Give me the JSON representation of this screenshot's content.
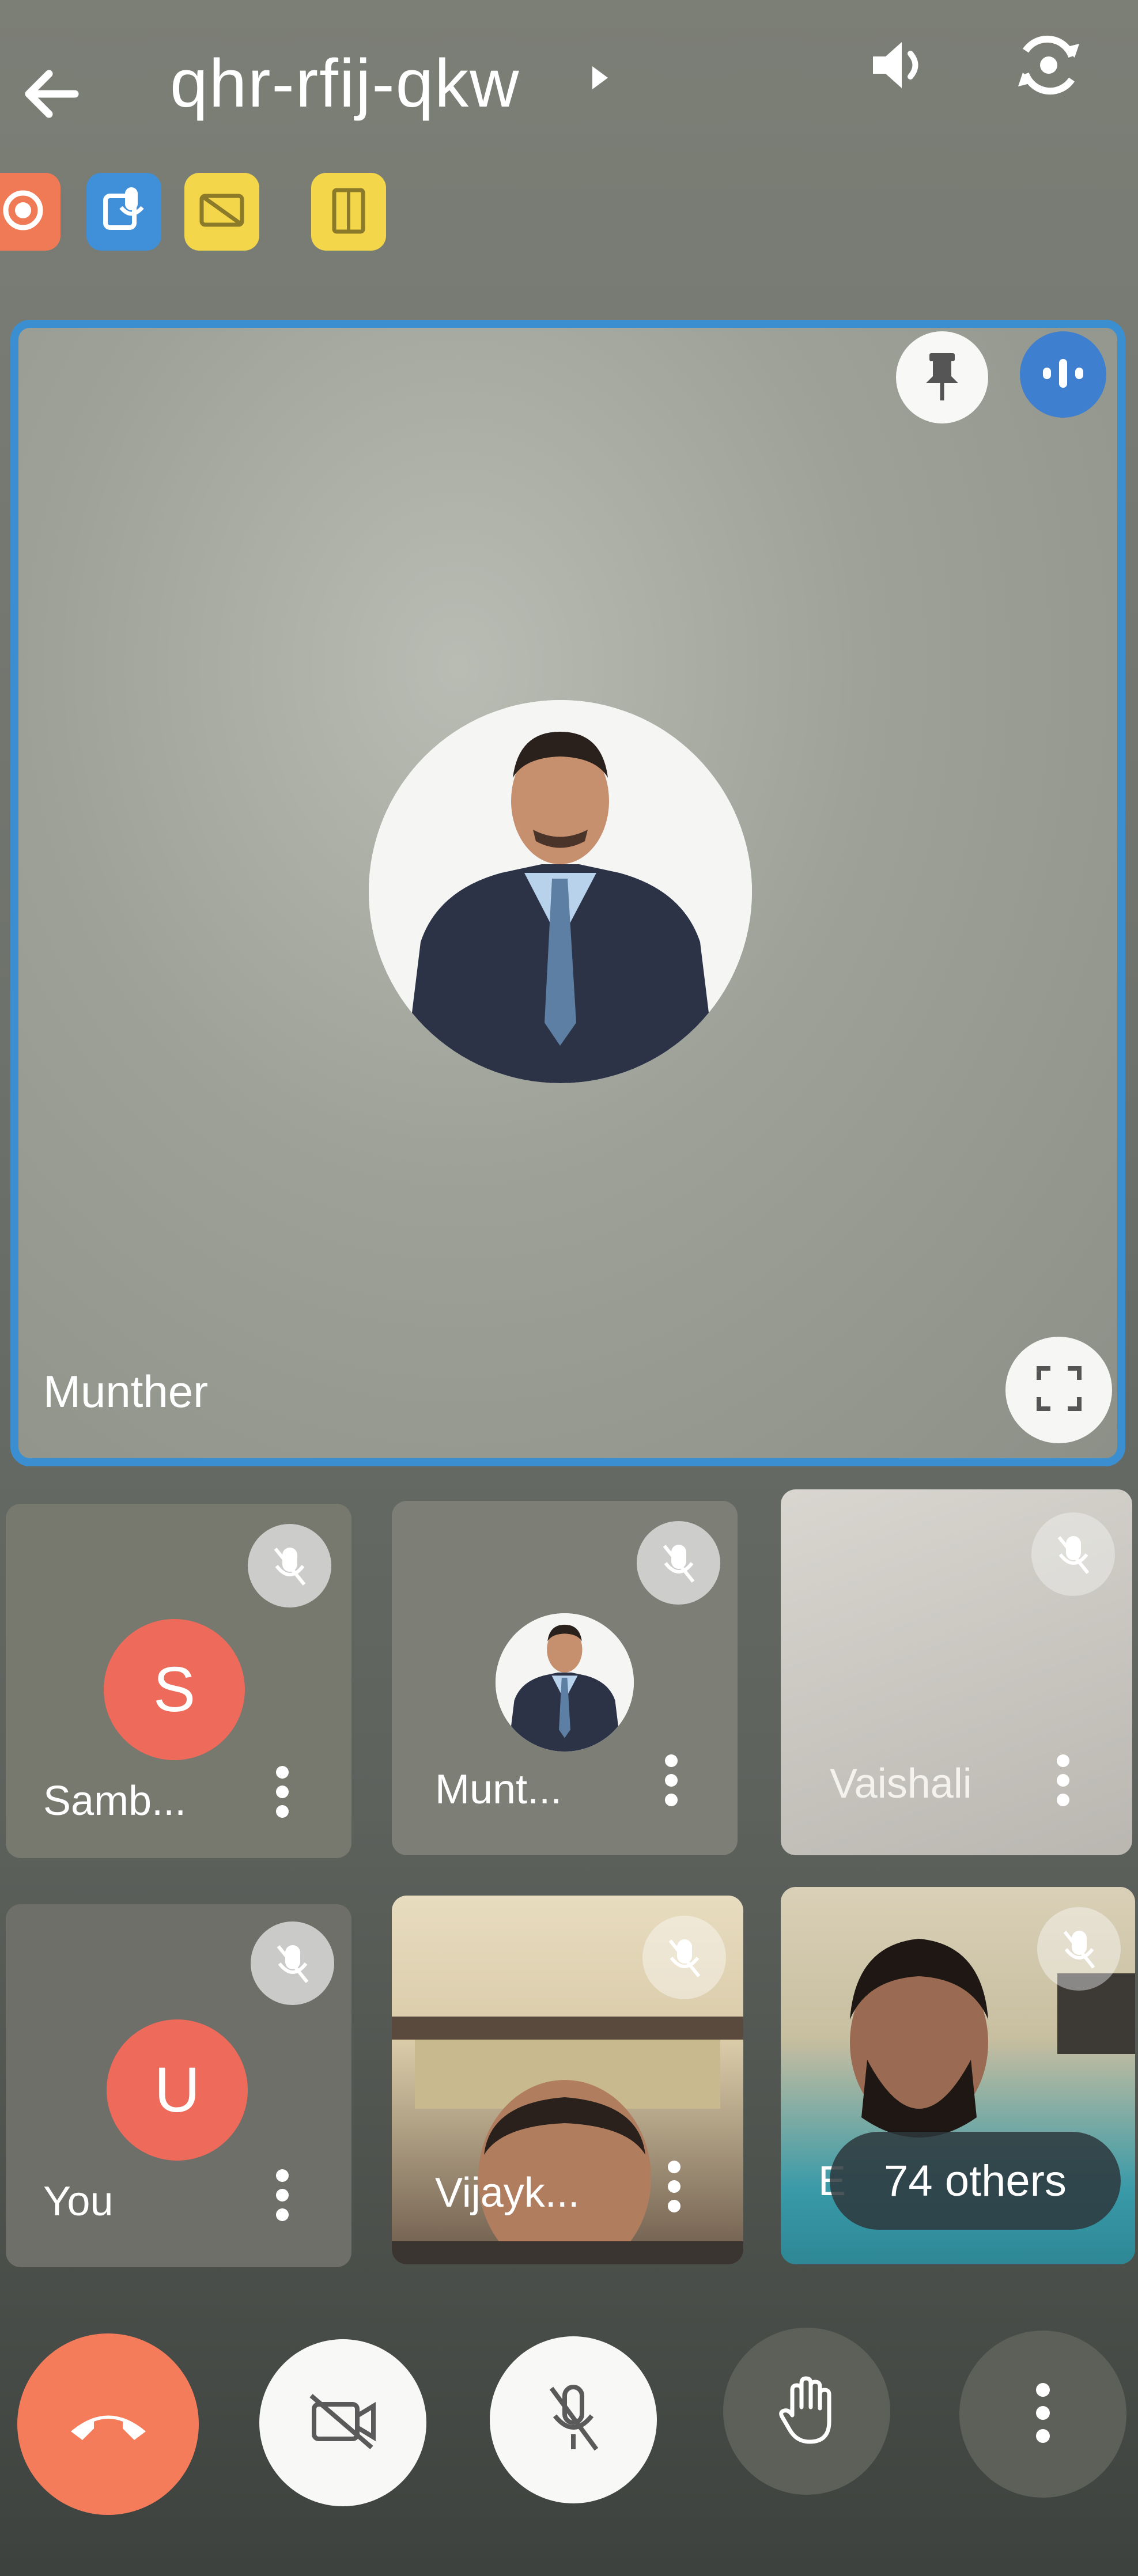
{
  "header": {
    "meeting_code": "qhr-rfij-qkw",
    "back_icon": "arrow-left-icon",
    "caret_icon": "caret-right-icon",
    "speaker_icon": "speaker-icon",
    "flip_camera_icon": "flip-camera-icon"
  },
  "status_chips": [
    {
      "icon": "record-icon",
      "color": "#f07a55"
    },
    {
      "icon": "mic-caption-icon",
      "color": "#3f8fd9"
    },
    {
      "icon": "camera-off-icon",
      "color": "#f4d64a"
    },
    {
      "icon": "door-icon",
      "color": "#f4d64a"
    }
  ],
  "main_tile": {
    "name": "Munther",
    "border_color": "#3b8fd0"
  },
  "grid": {
    "tiles": [
      {
        "name": "Samb...",
        "avatar_letter": "S",
        "avatar_color": "#ee6a5a"
      },
      {
        "name": "Munt..."
      },
      {
        "name": "Vaishali"
      },
      {
        "name": "You",
        "avatar_letter": "U",
        "avatar_color": "#ee6a5a"
      },
      {
        "name": "Vijayk..."
      },
      {
        "name": "E"
      }
    ],
    "others_label": "74 others"
  },
  "controls": {
    "end_call_color": "#f47c5a"
  }
}
